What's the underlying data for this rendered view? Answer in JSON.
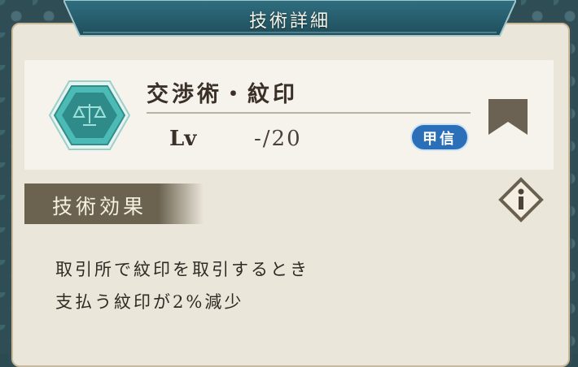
{
  "header": {
    "title": "技術詳細"
  },
  "skill": {
    "name": "交渉術・紋印",
    "lv_label": "Lv",
    "lv_value": "-/20",
    "badge": "甲信"
  },
  "effect": {
    "title": "技術効果",
    "lines": [
      "取引所で紋印を取引するとき",
      "支払う紋印が2%減少"
    ]
  },
  "colors": {
    "panel": "#ebe6da",
    "banner": "#2b5f6e",
    "badge": "#2a6fb8",
    "icon_teal": "#3fb3b0",
    "header_bar": "#6b6350"
  },
  "icons": {
    "skill": "scales-icon",
    "bookmark": "bookmark-icon",
    "info": "info-icon"
  }
}
